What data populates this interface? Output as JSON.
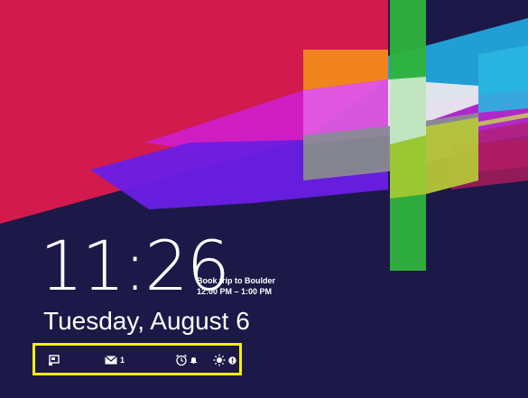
{
  "lock_screen": {
    "time": "11:26",
    "date": "Tuesday, August 6",
    "calendar_event": {
      "title": "Book trip to Boulder",
      "time_range": "12:00 PM – 1:00 PM"
    },
    "notifications": [
      {
        "icon": "travel-app-icon",
        "badge": ""
      },
      {
        "icon": "mail-icon",
        "badge": "1"
      },
      {
        "icon": "alarm-clock-icon",
        "badge": "bell-icon"
      },
      {
        "icon": "weather-sun-icon",
        "badge": "alert-icon"
      }
    ],
    "highlight_color": "#f2f20a",
    "background_color": "#1c1848"
  }
}
